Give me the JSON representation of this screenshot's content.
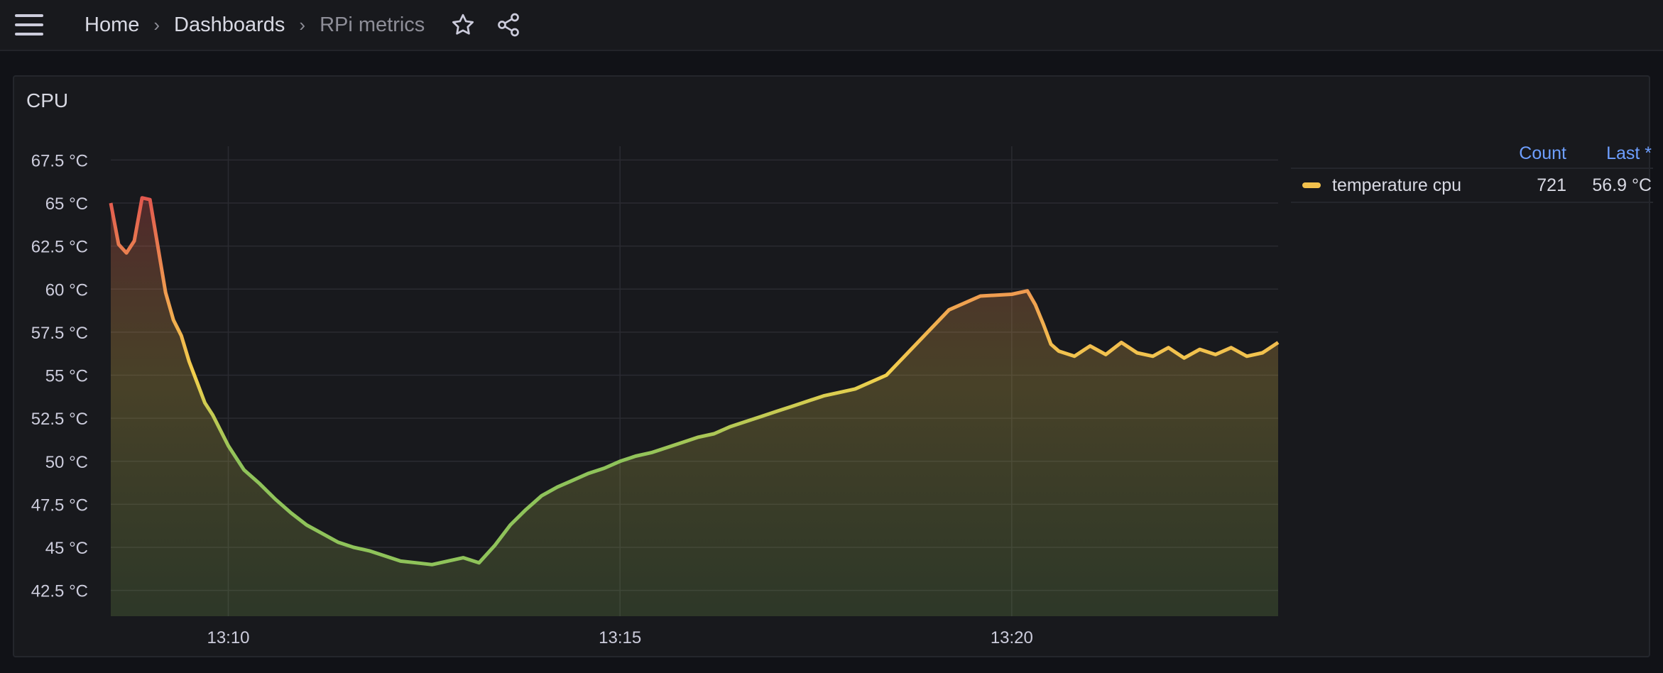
{
  "nav": {
    "breadcrumbs": [
      "Home",
      "Dashboards",
      "RPi metrics"
    ],
    "separator": "›"
  },
  "panel": {
    "title": "CPU"
  },
  "legend": {
    "header_count": "Count",
    "header_last": "Last *",
    "series_name": "temperature cpu",
    "count": "721",
    "last": "56.9 °C",
    "color": "#f2c14d"
  },
  "colors": {
    "hot": "#e0504f",
    "warm": "#f0a050",
    "mid": "#f2d04d",
    "cool": "#8fc35a"
  },
  "chart_data": {
    "type": "area",
    "y_ticks": [
      "67.5 °C",
      "65 °C",
      "62.5 °C",
      "60 °C",
      "57.5 °C",
      "55 °C",
      "52.5 °C",
      "50 °C",
      "47.5 °C",
      "45 °C",
      "42.5 °C"
    ],
    "x_ticks": [
      "13:10",
      "13:15",
      "13:20"
    ],
    "ylim": [
      41,
      68.3
    ],
    "xlim_minutes": [
      8.5,
      23.4
    ],
    "grid": true,
    "series": [
      {
        "name": "temperature cpu",
        "x": [
          8.5,
          8.6,
          8.7,
          8.8,
          8.9,
          9.0,
          9.1,
          9.2,
          9.3,
          9.4,
          9.5,
          9.6,
          9.7,
          9.8,
          9.9,
          10.0,
          10.2,
          10.4,
          10.6,
          10.8,
          11.0,
          11.2,
          11.4,
          11.6,
          11.8,
          12.0,
          12.2,
          12.4,
          12.6,
          12.8,
          13.0,
          13.2,
          13.4,
          13.6,
          13.8,
          14.0,
          14.2,
          14.4,
          14.6,
          14.8,
          15.0,
          15.2,
          15.4,
          15.6,
          15.8,
          16.0,
          16.2,
          16.4,
          16.6,
          16.8,
          17.0,
          17.2,
          17.4,
          17.6,
          17.8,
          18.0,
          18.4,
          18.8,
          19.2,
          19.6,
          20.0,
          20.2,
          20.3,
          20.4,
          20.5,
          20.6,
          20.8,
          21.0,
          21.2,
          21.4,
          21.6,
          21.8,
          22.0,
          22.2,
          22.4,
          22.6,
          22.8,
          23.0,
          23.2,
          23.4
        ],
        "values": [
          65,
          62.6,
          62.1,
          62.8,
          65.3,
          65.2,
          62.5,
          59.8,
          58.2,
          57.3,
          55.8,
          54.6,
          53.4,
          52.7,
          51.8,
          50.9,
          49.5,
          48.7,
          47.8,
          47.0,
          46.3,
          45.8,
          45.3,
          45.0,
          44.8,
          44.5,
          44.2,
          44.1,
          44.0,
          44.2,
          44.4,
          44.1,
          45.1,
          46.3,
          47.2,
          48.0,
          48.5,
          48.9,
          49.3,
          49.6,
          50.0,
          50.3,
          50.5,
          50.8,
          51.1,
          51.4,
          51.6,
          52.0,
          52.3,
          52.6,
          52.9,
          53.2,
          53.5,
          53.8,
          54.0,
          54.2,
          55.0,
          56.9,
          58.8,
          59.6,
          59.7,
          59.9,
          59.1,
          58.0,
          56.8,
          56.4,
          56.1,
          56.7,
          56.2,
          56.9,
          56.3,
          56.1,
          56.6,
          56.0,
          56.5,
          56.2,
          56.6,
          56.1,
          56.3,
          56.9
        ]
      }
    ]
  }
}
